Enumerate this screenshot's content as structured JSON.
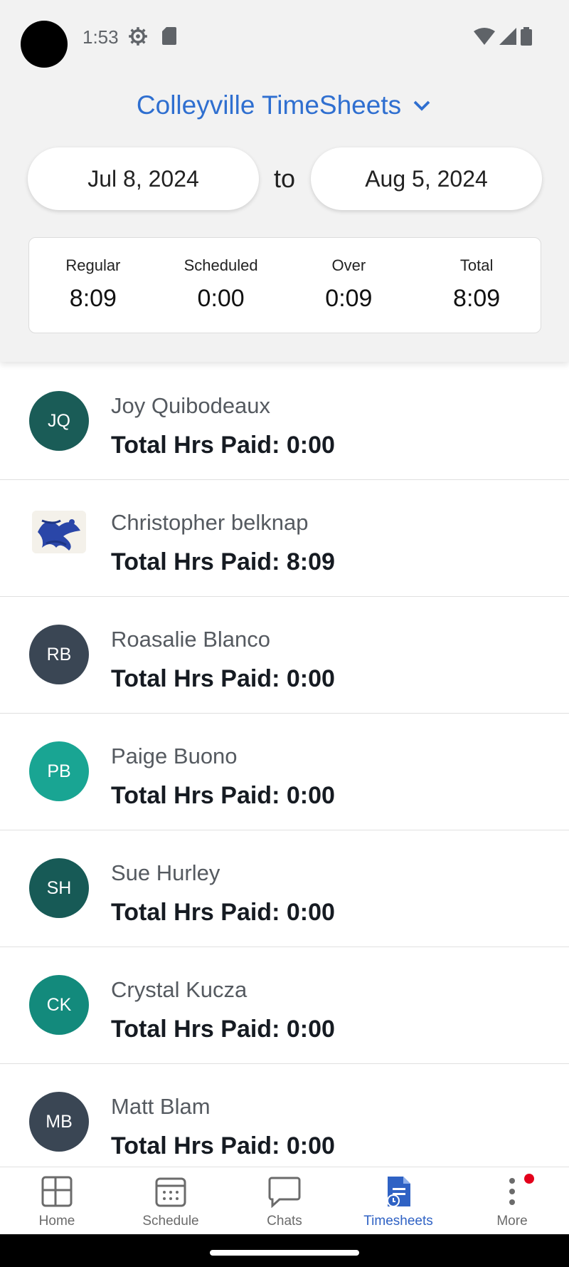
{
  "status": {
    "time": "1:53",
    "icons": [
      "gear-icon",
      "sd-card-icon",
      "wifi-icon",
      "signal-icon",
      "battery-icon"
    ]
  },
  "header": {
    "title": "Colleyville TimeSheets",
    "date_from": "Jul 8, 2024",
    "date_separator": "to",
    "date_to": "Aug 5, 2024"
  },
  "summary": [
    {
      "label": "Regular",
      "value": "8:09"
    },
    {
      "label": "Scheduled",
      "value": "0:00"
    },
    {
      "label": "Over",
      "value": "0:09"
    },
    {
      "label": "Total",
      "value": "8:09"
    }
  ],
  "employees": [
    {
      "initials": "JQ",
      "name": "Joy Quibodeaux",
      "hours": "Total Hrs Paid: 0:00",
      "color": "#1a5c57"
    },
    {
      "initials": "",
      "name": "Christopher belknap",
      "hours": "Total Hrs Paid: 8:09",
      "color": "#2a46a8",
      "photo": true
    },
    {
      "initials": "RB",
      "name": "Roasalie Blanco",
      "hours": "Total Hrs Paid: 0:00",
      "color": "#3a4654"
    },
    {
      "initials": "PB",
      "name": "Paige Buono",
      "hours": "Total Hrs Paid: 0:00",
      "color": "#19a593"
    },
    {
      "initials": "SH",
      "name": "Sue Hurley",
      "hours": "Total Hrs Paid: 0:00",
      "color": "#175a56"
    },
    {
      "initials": "CK",
      "name": "Crystal Kucza",
      "hours": "Total Hrs Paid: 0:00",
      "color": "#138a7c"
    },
    {
      "initials": "MB",
      "name": "Matt Blam",
      "hours": "Total Hrs Paid: 0:00",
      "color": "#3a4654"
    }
  ],
  "nav": [
    {
      "label": "Home",
      "icon": "home-grid-icon"
    },
    {
      "label": "Schedule",
      "icon": "calendar-icon"
    },
    {
      "label": "Chats",
      "icon": "chat-bubble-icon"
    },
    {
      "label": "Timesheets",
      "icon": "timesheet-icon",
      "active": true
    },
    {
      "label": "More",
      "icon": "more-vertical-icon",
      "badge": true
    }
  ],
  "colors": {
    "accent": "#2f6fd0",
    "active_nav": "#2f62c4",
    "badge": "#e3001b"
  }
}
